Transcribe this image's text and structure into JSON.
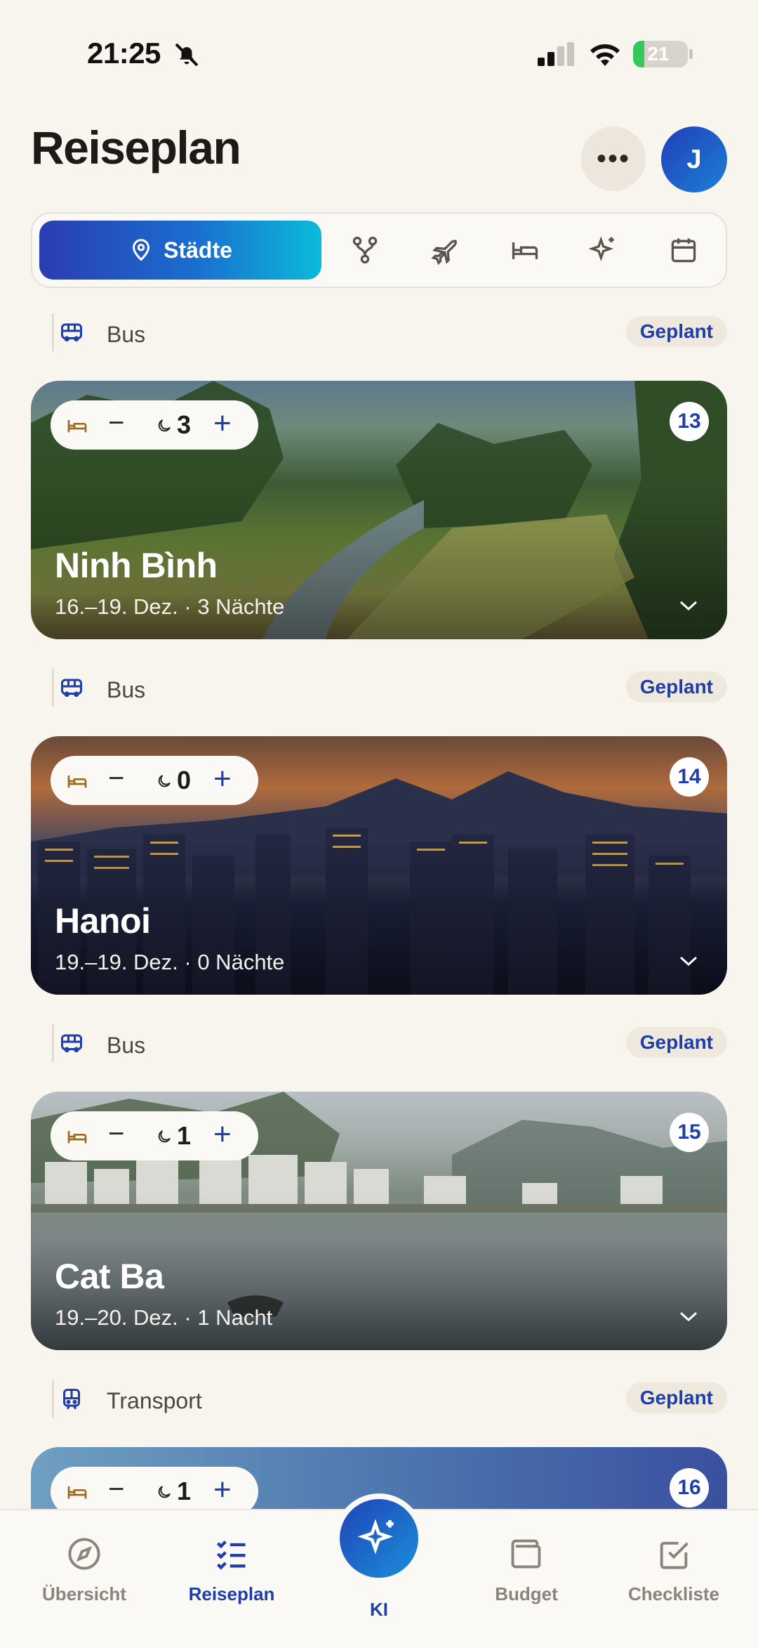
{
  "status_bar": {
    "time": "21:25",
    "battery": "21",
    "battery_level": 0.21
  },
  "header": {
    "title": "Reiseplan",
    "more_label": "•••",
    "avatar_initial": "J"
  },
  "tabs": {
    "active_label": "Städte",
    "icons": [
      "route-icon",
      "plane-icon",
      "bed-icon",
      "sparkles-icon",
      "calendar-icon"
    ]
  },
  "segments": [
    {
      "mode": "Bus",
      "status": "Geplant",
      "icon": "bus-icon"
    },
    {
      "mode": "Bus",
      "status": "Geplant",
      "icon": "bus-icon"
    },
    {
      "mode": "Bus",
      "status": "Geplant",
      "icon": "bus-icon"
    },
    {
      "mode": "Transport",
      "status": "Geplant",
      "icon": "train-icon"
    }
  ],
  "cities": [
    {
      "number": "13",
      "name": "Ninh Bình",
      "dates": "16.–19. Dez. · 3 Nächte",
      "nights": "3"
    },
    {
      "number": "14",
      "name": "Hanoi",
      "dates": "19.–19. Dez. · 0 Nächte",
      "nights": "0"
    },
    {
      "number": "15",
      "name": "Cat Ba",
      "dates": "19.–20. Dez. · 1 Nacht",
      "nights": "1"
    },
    {
      "number": "16",
      "name": "",
      "dates": "",
      "nights": "1"
    }
  ],
  "pill": {
    "minus": "−",
    "plus": "+"
  },
  "nav": {
    "overview": "Übersicht",
    "plan": "Reiseplan",
    "ai": "KI",
    "budget": "Budget",
    "checklist": "Checkliste"
  },
  "colors": {
    "accent": "#1f3ea8",
    "background": "#f8f4ee",
    "battery": "#34c759"
  }
}
